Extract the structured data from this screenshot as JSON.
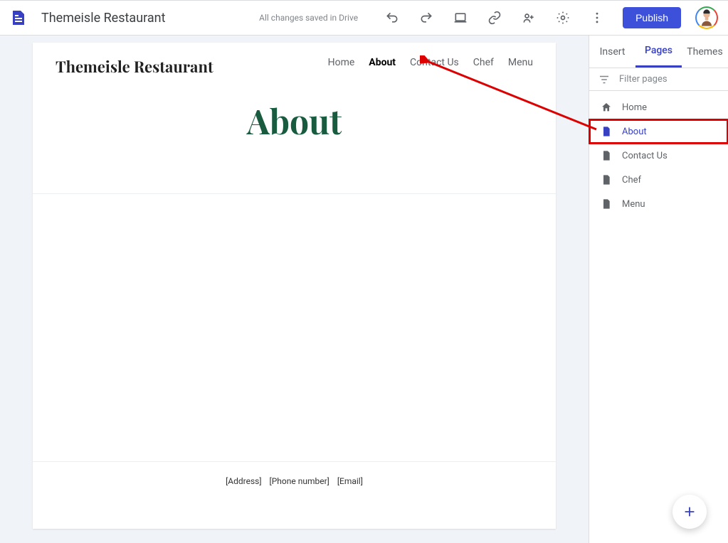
{
  "app": {
    "siteTitle": "Themeisle Restaurant",
    "savedStatus": "All changes saved in Drive",
    "publishLabel": "Publish"
  },
  "canvas": {
    "brand": "Themeisle Restaurant",
    "nav": {
      "home": "Home",
      "about": "About",
      "contact": "Contact Us",
      "chef": "Chef",
      "menu": "Menu"
    },
    "heroTitle": "About",
    "footer": {
      "address": "[Address]",
      "phone": "[Phone number]",
      "email": "[Email]"
    }
  },
  "sidebar": {
    "tabs": {
      "insert": "Insert",
      "pages": "Pages",
      "themes": "Themes"
    },
    "filterPlaceholder": "Filter pages",
    "pages": {
      "home": "Home",
      "about": "About",
      "contact": "Contact Us",
      "chef": "Chef",
      "menu": "Menu"
    }
  }
}
